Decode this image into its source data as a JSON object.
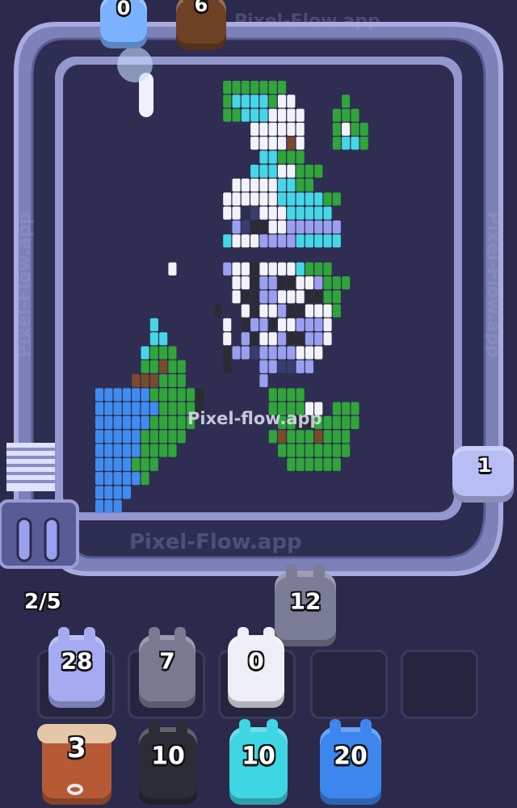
{
  "hud": {
    "progress": "2/5"
  },
  "watermarks": {
    "center": "Pixel-flow.app",
    "track_bottom": "Pixel-Flow.app",
    "track_top": "Pixel-Flow.app",
    "track_left": "Pixel-Flow.app",
    "track_right": "Pixel-Flow.app"
  },
  "colors": {
    "background": "#2b2a4c",
    "track": "#8d8fc6",
    "board": "#2f2e52",
    "periwinkle": "#9aa0ee",
    "gray": "#8f8fa6",
    "white": "#f2f2f8",
    "cyan": "#46d7e6",
    "blue": "#3f8cf0",
    "black": "#2b2b34",
    "brown": "#7b4a2c",
    "green": "#2fa53a",
    "navy": "#3a3c6e"
  },
  "track_shooters": [
    {
      "id": "top-blue",
      "count": "0",
      "color": "blue-icon"
    },
    {
      "id": "top-brown",
      "count": "6",
      "color": "brown-icon"
    },
    {
      "id": "right-periwinkle",
      "count": "1",
      "color": "periwinkle-icon"
    },
    {
      "id": "launching-gray",
      "count": "12",
      "color": "gray-icon"
    }
  ],
  "queue_slots": [
    {
      "count": "28",
      "color": "periwinkle",
      "filled": true
    },
    {
      "count": "7",
      "color": "gray",
      "filled": true
    },
    {
      "count": "0",
      "color": "white",
      "filled": true
    },
    {
      "count": "",
      "color": "",
      "filled": false
    },
    {
      "count": "",
      "color": "",
      "filled": false
    }
  ],
  "waiting_row": [
    {
      "count": "3",
      "color": "brown",
      "kind": "bull-icon"
    },
    {
      "count": "10",
      "color": "black",
      "kind": "shooter-icon"
    },
    {
      "count": "10",
      "color": "cyan",
      "kind": "shooter-icon"
    },
    {
      "count": "20",
      "color": "blue",
      "kind": "shooter-icon"
    }
  ]
}
